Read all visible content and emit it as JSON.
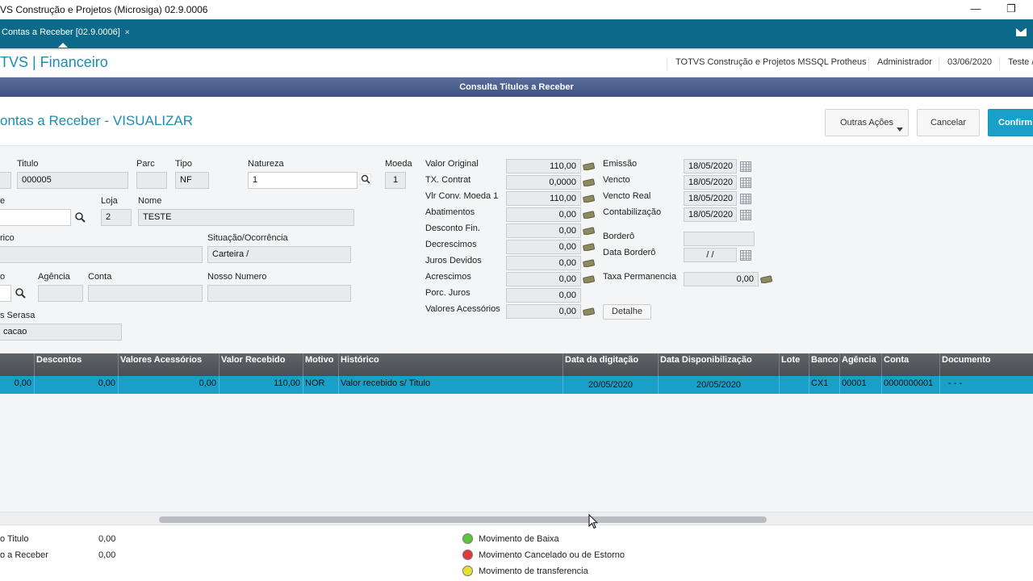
{
  "window": {
    "title": "VS Construção e Projetos (Microsiga) 02.9.0006",
    "minimize": "—",
    "maximize": "❐"
  },
  "tab": {
    "label": "Contas a Receber [02.9.0006]",
    "close": "×"
  },
  "header": {
    "brand": "TVS | Financeiro",
    "company": "TOTVS Construção e Projetos MSSQL Protheus",
    "user": "Administrador",
    "date": "03/06/2020",
    "env": "Teste /"
  },
  "dialog": {
    "title": "Consulta Titulos a Receber"
  },
  "page": {
    "title": "ontas a Receber - VISUALIZAR"
  },
  "buttons": {
    "other_actions": "Outras Ações",
    "cancel": "Cancelar",
    "confirm": "Confirm"
  },
  "form": {
    "titulo": {
      "label": "Titulo",
      "value": "000005"
    },
    "parc": {
      "label": "Parc",
      "value": ""
    },
    "tipo": {
      "label": "Tipo",
      "value": "NF"
    },
    "natureza": {
      "label": "Natureza",
      "value": "1"
    },
    "moeda": {
      "label": "Moeda",
      "value": "1"
    },
    "cliente": {
      "label": "e",
      "value": ""
    },
    "loja": {
      "label": "Loja",
      "value": "2"
    },
    "nome": {
      "label": "Nome",
      "value": "TESTE"
    },
    "historico": {
      "label": "rico",
      "value": ""
    },
    "situacao": {
      "label": "Situação/Ocorrência",
      "value": "Carteira /"
    },
    "portador": {
      "label": "o",
      "value": ""
    },
    "agencia": {
      "label": "Agência",
      "value": ""
    },
    "conta": {
      "label": "Conta",
      "value": ""
    },
    "nosso_numero": {
      "label": "Nosso Numero",
      "value": ""
    },
    "serasa": {
      "label": "s Serasa",
      "value": "cacao"
    }
  },
  "values": [
    {
      "label": "Valor Original",
      "value": "110,00"
    },
    {
      "label": "TX. Contrat",
      "value": "0,0000"
    },
    {
      "label": "Vlr Conv. Moeda 1",
      "value": "110,00"
    },
    {
      "label": "Abatimentos",
      "value": "0,00"
    },
    {
      "label": "Desconto Fin.",
      "value": "0,00"
    },
    {
      "label": "Decrescimos",
      "value": "0,00"
    },
    {
      "label": "Juros Devidos",
      "value": "0,00"
    },
    {
      "label": "Acrescimos",
      "value": "0,00"
    },
    {
      "label": "Porc. Juros",
      "value": "0,00"
    },
    {
      "label": "Valores Acessórios",
      "value": "0,00"
    }
  ],
  "detail_button": "Detalhe",
  "dates": [
    {
      "label": "Emissão",
      "value": "18/05/2020"
    },
    {
      "label": "Vencto",
      "value": "18/05/2020"
    },
    {
      "label": "Vencto Real",
      "value": "18/05/2020"
    },
    {
      "label": "Contabilização",
      "value": "18/05/2020"
    }
  ],
  "bordero": {
    "label": "Borderô",
    "value": ""
  },
  "data_bordero": {
    "label": "Data Borderô",
    "value": "  /  /"
  },
  "taxa_permanencia": {
    "label": "Taxa Permanencia",
    "value": "0,00"
  },
  "grid": {
    "headers": [
      "",
      "Descontos",
      "Valores Acessórios",
      "Valor Recebido",
      "Motivo",
      "Histórico",
      "Data da digitação",
      "Data Disponibilização",
      "Lote",
      "Banco",
      "Agência",
      "Conta",
      "Documento"
    ],
    "row": [
      "0,00",
      "0,00",
      "0,00",
      "110,00",
      "NOR",
      "Valor recebido s/ Titulo",
      "20/05/2020",
      "20/05/2020",
      "",
      "CX1",
      "00001",
      "0000000001",
      "-     - -"
    ]
  },
  "footer": {
    "left": [
      {
        "label": "o Titulo",
        "value": "0,00"
      },
      {
        "label": "o a Receber",
        "value": "0,00"
      }
    ],
    "legend": [
      {
        "label": "Movimento de Baixa",
        "color": "#5cc43a"
      },
      {
        "label": "Movimento Cancelado ou de Estorno",
        "color": "#e03a3a"
      },
      {
        "label": "Movimento de transferencia",
        "color": "#e8e02a"
      }
    ]
  }
}
